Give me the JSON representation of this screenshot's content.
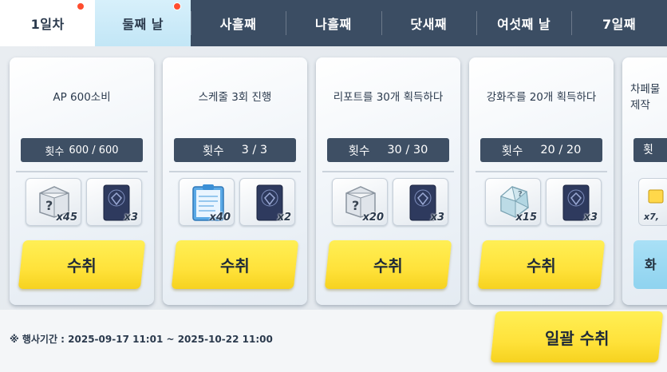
{
  "tabs": [
    {
      "label": "1일차",
      "state": "active",
      "has_badge": true
    },
    {
      "label": "둘째 날",
      "state": "next",
      "has_badge": true
    },
    {
      "label": "사흘째",
      "state": "locked",
      "has_badge": false
    },
    {
      "label": "나흘째",
      "state": "locked",
      "has_badge": false
    },
    {
      "label": "닷새째",
      "state": "locked",
      "has_badge": false
    },
    {
      "label": "여섯째 날",
      "state": "locked",
      "has_badge": false
    },
    {
      "label": "7일째",
      "state": "locked",
      "has_badge": false
    }
  ],
  "missions": [
    {
      "title": "AP 600소비",
      "count_label": "횟수",
      "count_value": "600 / 600",
      "rewards": [
        {
          "icon": "mystery-box-icon",
          "qty": "x45"
        },
        {
          "icon": "blue-book-icon",
          "qty": "x3"
        }
      ],
      "claim_label": "수취"
    },
    {
      "title": "스케줄 3회 진행",
      "count_label": "횟수",
      "count_value": "3 / 3",
      "rewards": [
        {
          "icon": "report-clipboard-icon",
          "qty": "x40"
        },
        {
          "icon": "blue-book-icon",
          "qty": "x2"
        }
      ],
      "claim_label": "수취"
    },
    {
      "title": "리포트를 30개 획득하다",
      "count_label": "횟수",
      "count_value": "30 / 30",
      "rewards": [
        {
          "icon": "mystery-box-icon",
          "qty": "x20"
        },
        {
          "icon": "blue-book-icon",
          "qty": "x3"
        }
      ],
      "claim_label": "수취"
    },
    {
      "title": "강화주를 20개 획득하다",
      "count_label": "횟수",
      "count_value": "20 / 20",
      "rewards": [
        {
          "icon": "enhancement-stone-icon",
          "qty": "x15"
        },
        {
          "icon": "blue-book-icon",
          "qty": "x3"
        }
      ],
      "claim_label": "수취"
    }
  ],
  "partial_mission": {
    "title_line1": "차페물",
    "title_line2": "제작",
    "count_label": "횟",
    "reward_qty": "x7,",
    "claim_label": "화"
  },
  "footer": {
    "event_period": "※ 행사기간 : 2025-09-17 11:01 ~ 2025-10-22 11:00",
    "claim_all_label": "일괄 수취"
  },
  "colors": {
    "tab_bar": "#3b4d63",
    "claim_button": "#ffe23a",
    "badge": "#ff4d2e"
  }
}
